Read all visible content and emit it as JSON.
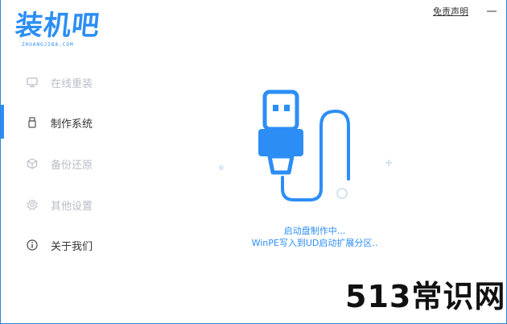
{
  "app": {
    "logo_text": "装机吧",
    "logo_subtitle": "ZHUANGJIBA.COM"
  },
  "titlebar": {
    "disclaimer_link": "免责声明",
    "minimize_icon": "minimize-icon"
  },
  "sidebar": {
    "items": [
      {
        "label": "在线重装",
        "icon": "monitor-icon",
        "state": "inactive"
      },
      {
        "label": "制作系统",
        "icon": "usb-drive-icon",
        "state": "active"
      },
      {
        "label": "备份还原",
        "icon": "cube-icon",
        "state": "inactive"
      },
      {
        "label": "其他设置",
        "icon": "gear-icon",
        "state": "inactive"
      },
      {
        "label": "关于我们",
        "icon": "info-icon",
        "state": "normal"
      }
    ]
  },
  "main": {
    "illustration": "usb-cable-illustration",
    "status_line1": "启动盘制作中...",
    "status_line2": "WinPE写入到UD启动扩展分区.."
  },
  "watermark": {
    "text": "513常识网"
  },
  "colors": {
    "accent": "#2c8ef5",
    "inactive_text": "#b9bec6",
    "text": "#333333"
  }
}
